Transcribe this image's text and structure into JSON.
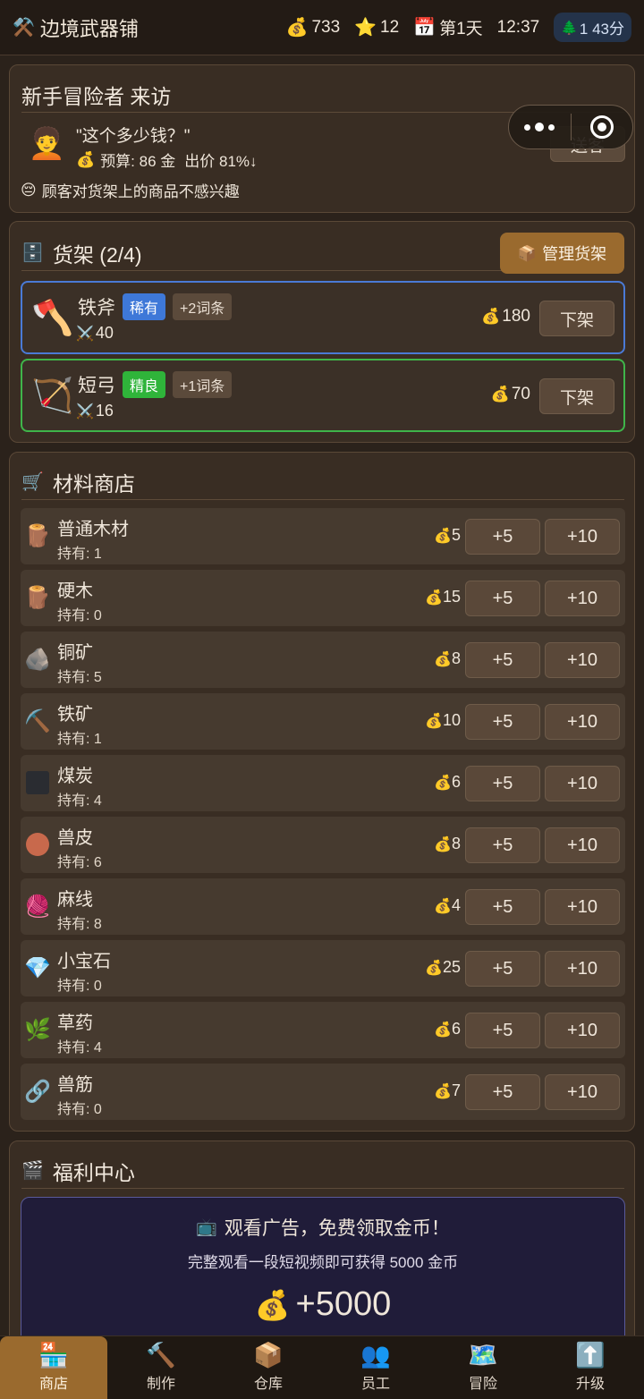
{
  "header": {
    "icon": "crossed-tools-icon",
    "title": "边境武器铺",
    "gold": "733",
    "stars": "12",
    "day": "第1天",
    "time": "12:37",
    "timer": "1 43分"
  },
  "visitor": {
    "title": "新手冒险者 来访",
    "quote": "\"这个多少钱？\"",
    "budget_label": "预算: 86 金",
    "offer": "出价 81%↓",
    "mood": "顾客对货架上的商品不感兴趣",
    "send_label": "送客"
  },
  "shelf": {
    "title": "货架 (2/4)",
    "manage_label": "管理货架",
    "items": [
      {
        "name": "铁斧",
        "rarity": "稀有",
        "affix": "+2词条",
        "atk": "40",
        "price": "180",
        "off_label": "下架",
        "icon": "axe-icon"
      },
      {
        "name": "短弓",
        "rarity": "精良",
        "affix": "+1词条",
        "atk": "16",
        "price": "70",
        "off_label": "下架",
        "icon": "bow-icon"
      }
    ]
  },
  "materials": {
    "title": "材料商店",
    "buy5": "+5",
    "buy10": "+10",
    "items": [
      {
        "name": "普通木材",
        "hold": "持有: 1",
        "price": "5",
        "icon": "log-icon"
      },
      {
        "name": "硬木",
        "hold": "持有: 0",
        "price": "15",
        "icon": "log-icon"
      },
      {
        "name": "铜矿",
        "hold": "持有: 5",
        "price": "8",
        "icon": "ore-icon"
      },
      {
        "name": "铁矿",
        "hold": "持有: 1",
        "price": "10",
        "icon": "pickaxe-icon"
      },
      {
        "name": "煤炭",
        "hold": "持有: 4",
        "price": "6",
        "icon": "coal-icon"
      },
      {
        "name": "兽皮",
        "hold": "持有: 6",
        "price": "8",
        "icon": "hide-icon"
      },
      {
        "name": "麻线",
        "hold": "持有: 8",
        "price": "4",
        "icon": "yarn-icon"
      },
      {
        "name": "小宝石",
        "hold": "持有: 0",
        "price": "25",
        "icon": "gem-icon"
      },
      {
        "name": "草药",
        "hold": "持有: 4",
        "price": "6",
        "icon": "herb-icon"
      },
      {
        "name": "兽筋",
        "hold": "持有: 0",
        "price": "7",
        "icon": "chain-icon"
      }
    ]
  },
  "welfare": {
    "title": "福利中心",
    "ad_title": "观看广告，免费领取金币！",
    "ad_sub": "完整观看一段短视频即可获得 5000 金币",
    "reward": "+5000"
  },
  "nav": [
    {
      "label": "商店",
      "icon": "shop-icon",
      "active": true
    },
    {
      "label": "制作",
      "icon": "hammer-icon",
      "active": false
    },
    {
      "label": "仓库",
      "icon": "box-icon",
      "active": false
    },
    {
      "label": "员工",
      "icon": "people-icon",
      "active": false
    },
    {
      "label": "冒险",
      "icon": "map-icon",
      "active": false
    },
    {
      "label": "升级",
      "icon": "up-arrow-icon",
      "active": false
    }
  ]
}
